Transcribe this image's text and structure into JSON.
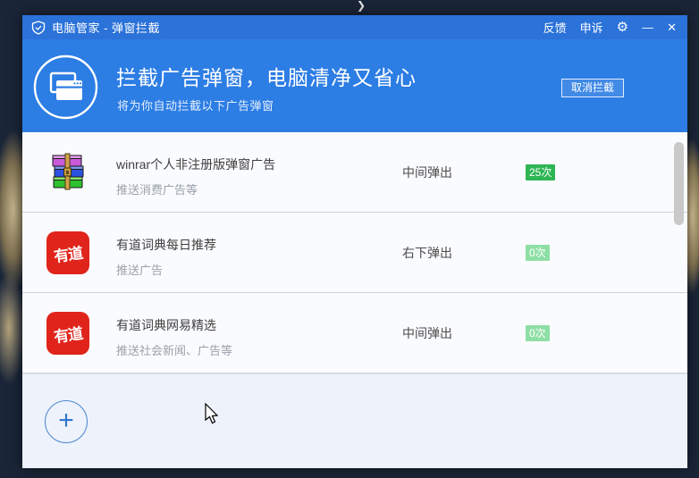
{
  "titlebar": {
    "title": "电脑管家 - 弹窗拦截",
    "feedback_label": "反馈",
    "appeal_label": "申诉",
    "gear_glyph": "⚙",
    "minimize_glyph": "—",
    "close_glyph": "✕"
  },
  "header": {
    "title": "拦截广告弹窗，电脑清净又省心",
    "subtitle": "将为你自动拦截以下广告弹窗",
    "cancel_button_label": "取消拦截"
  },
  "rows": [
    {
      "app": "winrar",
      "title": "winrar个人非注册版弹窗广告",
      "desc": "推送消费广告等",
      "position": "中间弹出",
      "count": "25次",
      "count_level": "high"
    },
    {
      "app": "youdao",
      "icon_text": "有道",
      "title": "有道词典每日推荐",
      "desc": "推送广告",
      "position": "右下弹出",
      "count": "0次",
      "count_level": "low"
    },
    {
      "app": "youdao",
      "icon_text": "有道",
      "title": "有道词典网易精选",
      "desc": "推送社会新闻、广告等",
      "position": "中间弹出",
      "count": "0次",
      "count_level": "low"
    }
  ],
  "footer": {
    "add_glyph": "+"
  },
  "colors": {
    "accent_blue": "#2c7de4",
    "titlebar_blue": "#2b72d9",
    "badge_high": "#2eb554",
    "badge_low": "#8edfa5",
    "youdao_red": "#e0241b"
  }
}
